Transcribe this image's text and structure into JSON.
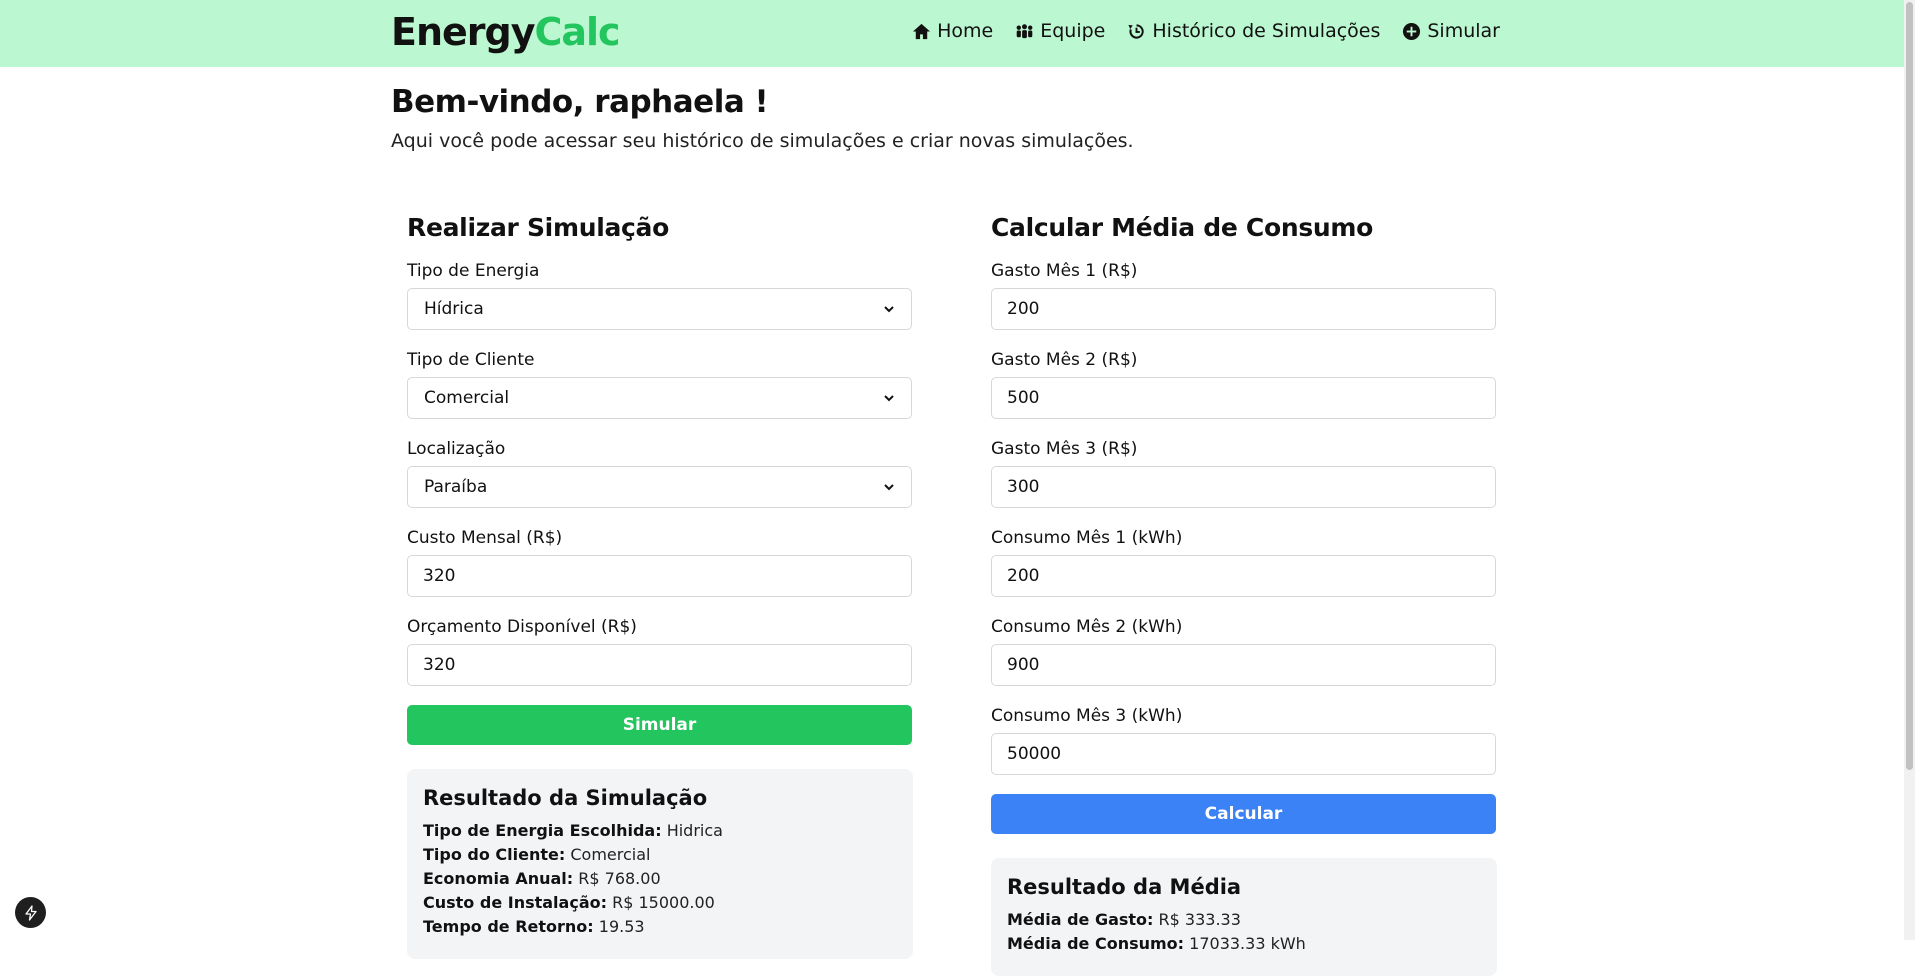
{
  "brand": {
    "part1": "Energy",
    "part2": "Calc"
  },
  "nav": [
    {
      "label": "Home",
      "icon": "home-icon"
    },
    {
      "label": "Equipe",
      "icon": "team-icon"
    },
    {
      "label": "Histórico de Simulações",
      "icon": "history-icon"
    },
    {
      "label": "Simular",
      "icon": "plus-circle-icon"
    }
  ],
  "welcome": "Bem-vindo, raphaela !",
  "subtitle": "Aqui você pode acessar seu histórico de simulações e criar novas simulações.",
  "simulation": {
    "title": "Realizar Simulação",
    "energy_type": {
      "label": "Tipo de Energia",
      "value": "Hídrica"
    },
    "client_type": {
      "label": "Tipo de Cliente",
      "value": "Comercial"
    },
    "location": {
      "label": "Localização",
      "value": "Paraíba"
    },
    "monthly_cost": {
      "label": "Custo Mensal (R$)",
      "value": "320"
    },
    "budget": {
      "label": "Orçamento Disponível (R$)",
      "value": "320"
    },
    "submit_label": "Simular",
    "result": {
      "title": "Resultado da Simulação",
      "rows": [
        {
          "key": "Tipo de Energia Escolhida:",
          "value": "Hidrica"
        },
        {
          "key": "Tipo do Cliente:",
          "value": "Comercial"
        },
        {
          "key": "Economia Anual:",
          "value": "R$ 768.00"
        },
        {
          "key": "Custo de Instalação:",
          "value": "R$ 15000.00"
        },
        {
          "key": "Tempo de Retorno:",
          "value": "19.53"
        }
      ]
    }
  },
  "average": {
    "title": "Calcular Média de Consumo",
    "fields": [
      {
        "label": "Gasto Mês 1 (R$)",
        "value": "200"
      },
      {
        "label": "Gasto Mês 2 (R$)",
        "value": "500"
      },
      {
        "label": "Gasto Mês 3 (R$)",
        "value": "300"
      },
      {
        "label": "Consumo Mês 1 (kWh)",
        "value": "200"
      },
      {
        "label": "Consumo Mês 2 (kWh)",
        "value": "900"
      },
      {
        "label": "Consumo Mês 3 (kWh)",
        "value": "50000"
      }
    ],
    "submit_label": "Calcular",
    "result": {
      "title": "Resultado da Média",
      "rows": [
        {
          "key": "Média de Gasto:",
          "value": "R$ 333.33"
        },
        {
          "key": "Média de Consumo:",
          "value": "17033.33 kWh"
        }
      ]
    }
  },
  "colors": {
    "header_bg": "#bbf7d0",
    "brand_accent": "#22c55e",
    "simulate_button": "#22c55e",
    "calculate_button": "#3b82f6"
  }
}
